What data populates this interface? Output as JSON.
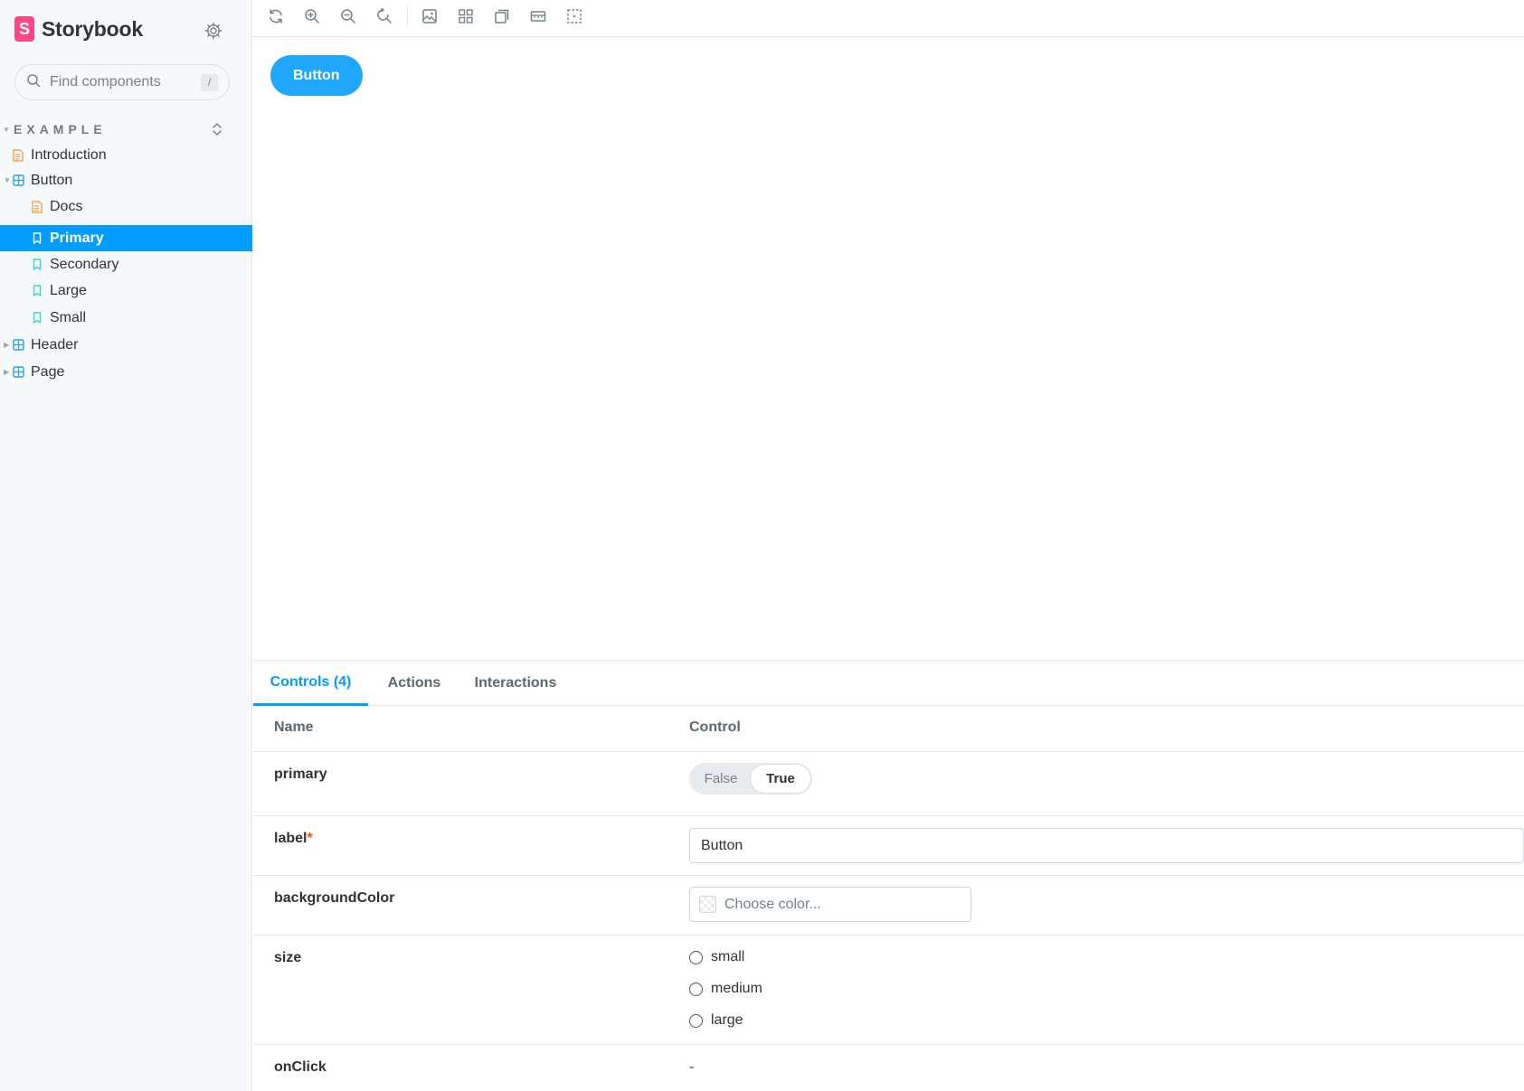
{
  "sidebar": {
    "brand": "Storybook",
    "brand_logo_letter": "S",
    "search_placeholder": "Find components",
    "search_shortcut": "/",
    "group_title": "EXAMPLE",
    "items": [
      {
        "label": "Introduction",
        "icon": "document-icon"
      },
      {
        "label": "Button",
        "icon": "component-icon"
      },
      {
        "label": "Docs",
        "icon": "document-icon"
      },
      {
        "label": "Primary",
        "icon": "bookmark-icon"
      },
      {
        "label": "Secondary",
        "icon": "bookmark-icon"
      },
      {
        "label": "Large",
        "icon": "bookmark-icon"
      },
      {
        "label": "Small",
        "icon": "bookmark-icon"
      },
      {
        "label": "Header",
        "icon": "component-icon"
      },
      {
        "label": "Page",
        "icon": "component-icon"
      }
    ],
    "selected_item": "Primary"
  },
  "toolbar": {
    "buttons": [
      "reload-icon",
      "zoom-in-icon",
      "zoom-out-icon",
      "zoom-reset-icon",
      "background-icon",
      "grid-icon",
      "viewport-icon",
      "measure-icon",
      "outline-icon"
    ]
  },
  "canvas": {
    "story_button_label": "Button"
  },
  "panel": {
    "tabs": [
      {
        "label": "Controls (4)",
        "active": true
      },
      {
        "label": "Actions",
        "active": false
      },
      {
        "label": "Interactions",
        "active": false
      }
    ],
    "headers": {
      "name": "Name",
      "control": "Control"
    },
    "rows": {
      "primary": {
        "name": "primary",
        "false_label": "False",
        "true_label": "True",
        "value": true
      },
      "label": {
        "name": "label",
        "required_mark": "*",
        "value": "Button"
      },
      "backgroundColor": {
        "name": "backgroundColor",
        "placeholder": "Choose color..."
      },
      "size": {
        "name": "size",
        "options": [
          "small",
          "medium",
          "large"
        ]
      },
      "onClick": {
        "name": "onClick",
        "value": "-"
      }
    }
  },
  "colors": {
    "accent": "#029cfd",
    "brand": "#ff4785",
    "story_button": "#1ea7fd",
    "sidebar_bg": "#f6f9fc",
    "document_icon": "#f0a54a",
    "component_icon": "#2aa3e0",
    "story_icon": "#37d5d3"
  }
}
